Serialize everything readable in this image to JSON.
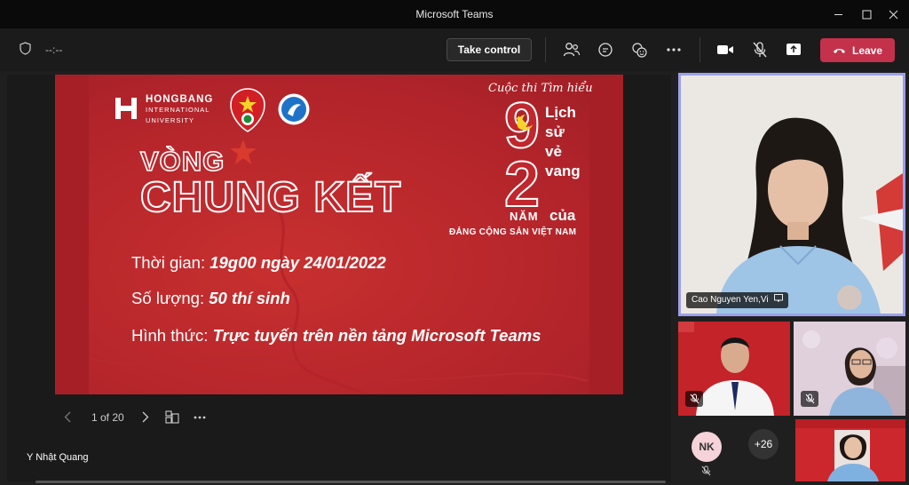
{
  "window": {
    "title": "Microsoft Teams"
  },
  "toolbar": {
    "timer": "--:--",
    "take_control_label": "Take control",
    "leave_label": "Leave"
  },
  "slide": {
    "logo_name": "HONGBANG",
    "logo_sub1": "INTERNATIONAL",
    "logo_sub2": "UNIVERSITY",
    "heading_small": "VÒNG",
    "heading_large": "CHUNG KẾT",
    "contest_tagline": "Cuộc thi Tìm hiểu",
    "contest_number_1": "9",
    "contest_number_2": "2",
    "contest_word_1": "Lịch",
    "contest_word_2": "sử",
    "contest_word_3": "vẻ",
    "contest_word_4": "vang",
    "contest_nam": "NĂM",
    "contest_cua": "của",
    "contest_party": "ĐẢNG CỘNG SẢN VIỆT NAM",
    "time_label": "Thời gian:",
    "time_value": "19g00 ngày 24/01/2022",
    "count_label": "Số lượng:",
    "count_value": "50 thí sinh",
    "format_label": "Hình thức:",
    "format_value": "Trực tuyến trên nền tảng Microsoft Teams"
  },
  "slide_nav": {
    "page_indicator": "1 of 20"
  },
  "presenter": {
    "name": "Y Nhật Quang"
  },
  "participants": {
    "main_name": "Cao Nguyen Yen,Vi",
    "avatar_initials": "NK",
    "more_count": "+26"
  },
  "colors": {
    "leave": "#c4314b",
    "active_border": "#9aa0e8",
    "slide_red": "#c1272d"
  }
}
